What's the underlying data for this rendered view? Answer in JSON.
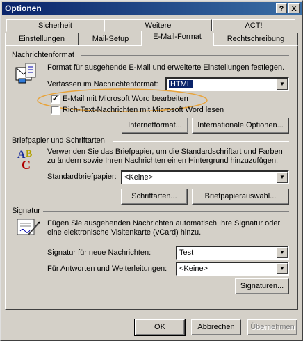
{
  "window": {
    "title": "Optionen",
    "help_btn": "?",
    "close_btn": "X"
  },
  "tabs_back": [
    "Sicherheit",
    "Weitere",
    "ACT!"
  ],
  "tabs_front": [
    "Einstellungen",
    "Mail-Setup",
    "E-Mail-Format",
    "Rechtschreibung"
  ],
  "active_tab": "E-Mail-Format",
  "nachrichtenformat": {
    "title": "Nachrichtenformat",
    "desc": "Format für ausgehende E-Mail und erweiterte Einstellungen festlegen.",
    "compose_label": "Verfassen im Nachrichtenformat:",
    "compose_value": "HTML",
    "word_checkbox": "E-Mail mit Microsoft Word bearbeiten",
    "word_checked": true,
    "rtf_checkbox": "Rich-Text-Nachrichten mit Microsoft Word lesen",
    "rtf_checked": false,
    "btn_internet": "Internetformat...",
    "btn_international": "Internationale Optionen..."
  },
  "briefpapier": {
    "title": "Briefpapier und Schriftarten",
    "desc1": "Verwenden Sie das Briefpapier, um die Standardschriftart und Farben",
    "desc2": "zu ändern sowie Ihren Nachrichten einen Hintergrund hinzuzufügen.",
    "standard_label": "Standardbriefpapier:",
    "standard_value": "<Keine>",
    "btn_schriftarten": "Schriftarten...",
    "btn_auswahl": "Briefpapierauswahl..."
  },
  "signatur": {
    "title": "Signatur",
    "desc1": "Fügen Sie ausgehenden Nachrichten automatisch Ihre Signatur oder",
    "desc2": "eine elektronische Visitenkarte (vCard) hinzu.",
    "new_label": "Signatur für neue Nachrichten:",
    "new_value": "Test",
    "reply_label": "Für Antworten und Weiterleitungen:",
    "reply_value": "<Keine>",
    "btn_signaturen": "Signaturen..."
  },
  "footer": {
    "ok": "OK",
    "cancel": "Abbrechen",
    "apply": "Übernehmen"
  },
  "colors": {
    "titlebar": "#0a246a",
    "face": "#d4d0c8",
    "highlight_ellipse": "#e8a33a"
  }
}
